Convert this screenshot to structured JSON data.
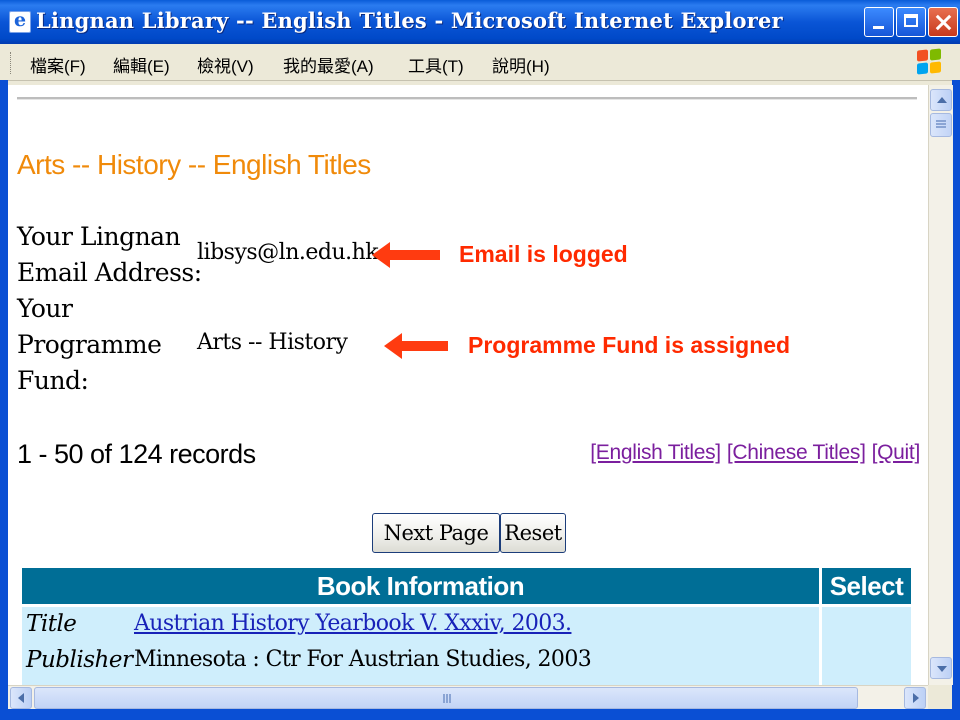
{
  "window": {
    "title": "Lingnan Library -- English Titles - Microsoft Internet Explorer",
    "app_icon": "ie-icon"
  },
  "menu": {
    "items": [
      "檔案(F)",
      "編輯(E)",
      "檢視(V)",
      "我的最愛(A)",
      "工具(T)",
      "說明(H)"
    ]
  },
  "page": {
    "heading": "Arts -- History -- English Titles",
    "email_label_line1": "Your Lingnan",
    "email_label_line2": "Email Address:",
    "email_value": "libsys@ln.edu.hk",
    "fund_label_line1": "Your",
    "fund_label_line2": "Programme",
    "fund_label_line3": "Fund:",
    "fund_value": "Arts -- History",
    "records": "1 - 50 of 124 records",
    "nav_links": [
      "[English Titles]",
      "[Chinese Titles]",
      "[Quit]"
    ],
    "buttons": {
      "next": "Next Page",
      "reset": "Reset"
    }
  },
  "annotations": {
    "email": "Email is logged",
    "fund": "Programme Fund is assigned",
    "color": "#ff3b10"
  },
  "table": {
    "headers": [
      "Book Information",
      "Select"
    ],
    "header_color": "#006e96",
    "row_color": "#cfeefc",
    "rows": [
      {
        "title_label": "Title",
        "title": "Austrian History Yearbook V. Xxxiv, 2003.",
        "publisher_label": "Publisher",
        "publisher": "Minnesota : Ctr For Austrian Studies, 2003"
      }
    ]
  },
  "colors": {
    "heading": "#f08a0a",
    "link_visited": "#7b1f9e",
    "link": "#1822b8",
    "titlebar": "#0a55d6"
  }
}
